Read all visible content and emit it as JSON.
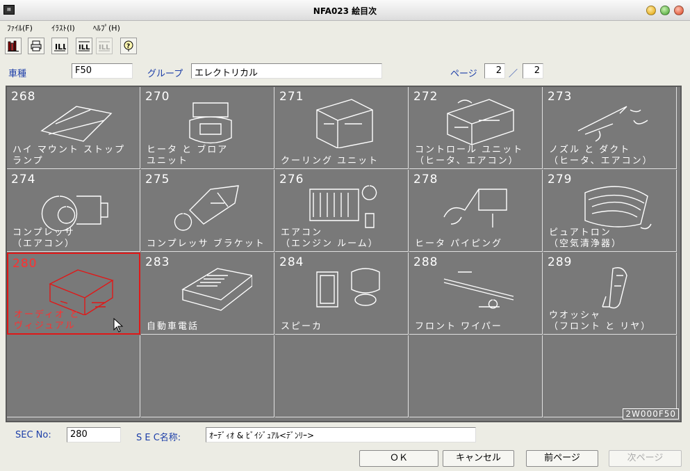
{
  "window": {
    "title": "NFA023 絵目次"
  },
  "menu": [
    {
      "label": "ﾌｧｲﾙ(F)"
    },
    {
      "label": "ｲﾗｽﾄ(I)"
    },
    {
      "label": "ﾍﾙﾌﾟ(H)"
    }
  ],
  "toolbar": {
    "buttons": [
      {
        "icon": "bookshelf-icon"
      },
      {
        "icon": "printer-icon"
      },
      {
        "icon": "illust-icon"
      },
      {
        "icon": "illust-list-icon"
      },
      {
        "icon": "illust-swap-icon"
      },
      {
        "icon": "help-icon"
      }
    ]
  },
  "header": {
    "model_label": "車種",
    "model_value": "F50",
    "group_label": "グループ",
    "group_value": "エレクトリカル",
    "page_label": "ページ",
    "page_current": "2",
    "page_separator": "／",
    "page_total": "2"
  },
  "grid": {
    "selected_code": "280",
    "cells": [
      {
        "code": "268",
        "name": "ハイ マウント ストップ\nランプ"
      },
      {
        "code": "270",
        "name": "ヒータ と ブロア\nユニット"
      },
      {
        "code": "271",
        "name": "クーリング ユニット"
      },
      {
        "code": "272",
        "name": "コントロール ユニット\n（ヒータ、エアコン）"
      },
      {
        "code": "273",
        "name": "ノズル と ダクト\n（ヒータ、エアコン）"
      },
      {
        "code": "274",
        "name": "コンプレッサ\n（エアコン）"
      },
      {
        "code": "275",
        "name": "コンプレッサ ブラケット"
      },
      {
        "code": "276",
        "name": "エアコン\n（エンジン ルーム）"
      },
      {
        "code": "278",
        "name": "ヒータ パイピング"
      },
      {
        "code": "279",
        "name": "ピュアトロン\n（空気清浄器）"
      },
      {
        "code": "280",
        "name": "オーディオ と\nヴィジュアル"
      },
      {
        "code": "283",
        "name": "自動車電話"
      },
      {
        "code": "284",
        "name": "スピーカ"
      },
      {
        "code": "288",
        "name": "フロント ワイパー"
      },
      {
        "code": "289",
        "name": "ウオッシャ\n（フロント と リヤ）"
      }
    ],
    "illustration_code": "2W000F50"
  },
  "footer": {
    "sec_no_label": "SEC No:",
    "sec_no_value": "280",
    "sec_name_label": "S E C名称:",
    "sec_name_value": "ｵｰﾃﾞｨｵ & ﾋﾞｲｼﾞｭｱﾙ<ﾃﾞﾝﾘｰ>",
    "ok_label": "ＯＫ",
    "cancel_label": "キャンセル",
    "prev_label": "前ページ",
    "next_label": "次ページ"
  },
  "colors": {
    "label_blue": "#1c3ea8",
    "grid_bg": "#797979",
    "selected_red": "#e01818"
  }
}
